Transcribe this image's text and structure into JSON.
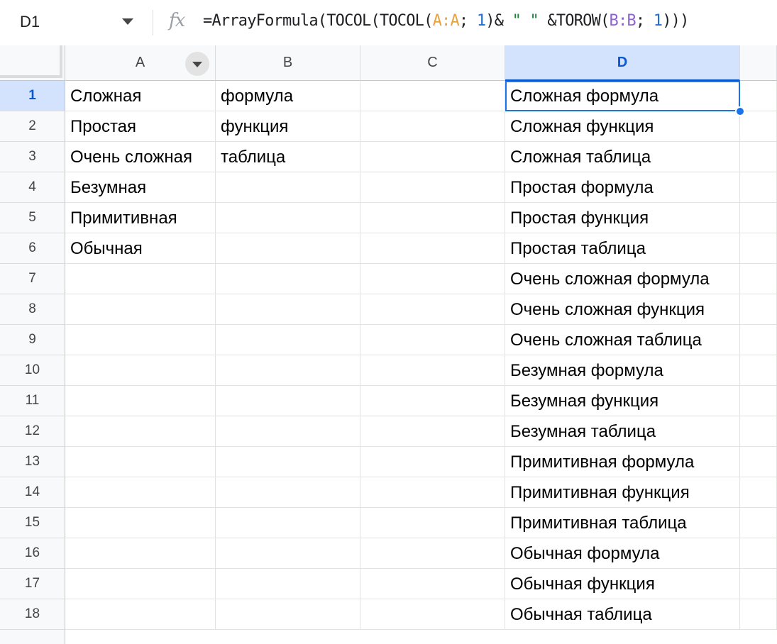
{
  "name_box": {
    "value": "D1"
  },
  "formula_bar": {
    "fx_label": "fx",
    "tokens": [
      {
        "text": "=ArrayFormula(TOCOL(TOCOL(",
        "kind": "plain"
      },
      {
        "text": "A:A",
        "kind": "range-a"
      },
      {
        "text": "; ",
        "kind": "plain"
      },
      {
        "text": "1",
        "kind": "num"
      },
      {
        "text": ")& ",
        "kind": "plain"
      },
      {
        "text": "\" \"",
        "kind": "str"
      },
      {
        "text": " &TOROW(",
        "kind": "plain"
      },
      {
        "text": "B:B",
        "kind": "range-b"
      },
      {
        "text": "; ",
        "kind": "plain"
      },
      {
        "text": "1",
        "kind": "num"
      },
      {
        "text": ")))",
        "kind": "plain"
      }
    ]
  },
  "columns": [
    {
      "label": "A",
      "filter": true
    },
    {
      "label": "B",
      "filter": false
    },
    {
      "label": "C",
      "filter": false
    },
    {
      "label": "D",
      "filter": false,
      "selected": true
    }
  ],
  "rows": [
    {
      "n": "1",
      "a": "Сложная",
      "b": "формула",
      "c": "",
      "d": "Сложная формула"
    },
    {
      "n": "2",
      "a": "Простая",
      "b": "функция",
      "c": "",
      "d": "Сложная функция"
    },
    {
      "n": "3",
      "a": "Очень сложная",
      "b": "таблица",
      "c": "",
      "d": "Сложная таблица"
    },
    {
      "n": "4",
      "a": "Безумная",
      "b": "",
      "c": "",
      "d": "Простая формула"
    },
    {
      "n": "5",
      "a": "Примитивная",
      "b": "",
      "c": "",
      "d": "Простая функция"
    },
    {
      "n": "6",
      "a": "Обычная",
      "b": "",
      "c": "",
      "d": "Простая таблица"
    },
    {
      "n": "7",
      "a": "",
      "b": "",
      "c": "",
      "d": "Очень сложная формула"
    },
    {
      "n": "8",
      "a": "",
      "b": "",
      "c": "",
      "d": "Очень сложная функция"
    },
    {
      "n": "9",
      "a": "",
      "b": "",
      "c": "",
      "d": "Очень сложная таблица"
    },
    {
      "n": "10",
      "a": "",
      "b": "",
      "c": "",
      "d": "Безумная формула"
    },
    {
      "n": "11",
      "a": "",
      "b": "",
      "c": "",
      "d": "Безумная функция"
    },
    {
      "n": "12",
      "a": "",
      "b": "",
      "c": "",
      "d": "Безумная таблица"
    },
    {
      "n": "13",
      "a": "",
      "b": "",
      "c": "",
      "d": "Примитивная формула"
    },
    {
      "n": "14",
      "a": "",
      "b": "",
      "c": "",
      "d": "Примитивная функция"
    },
    {
      "n": "15",
      "a": "",
      "b": "",
      "c": "",
      "d": "Примитивная таблица"
    },
    {
      "n": "16",
      "a": "",
      "b": "",
      "c": "",
      "d": "Обычная формула"
    },
    {
      "n": "17",
      "a": "",
      "b": "",
      "c": "",
      "d": "Обычная функция"
    },
    {
      "n": "18",
      "a": "",
      "b": "",
      "c": "",
      "d": "Обычная таблица"
    }
  ],
  "colors": {
    "selection": "#1a73e8",
    "header_selected_bg": "#d3e3fd",
    "header_bg": "#f8f9fa",
    "range_a": "#e8a33d",
    "range_b": "#8e63ce",
    "number": "#1e6fd0",
    "string": "#188038"
  }
}
